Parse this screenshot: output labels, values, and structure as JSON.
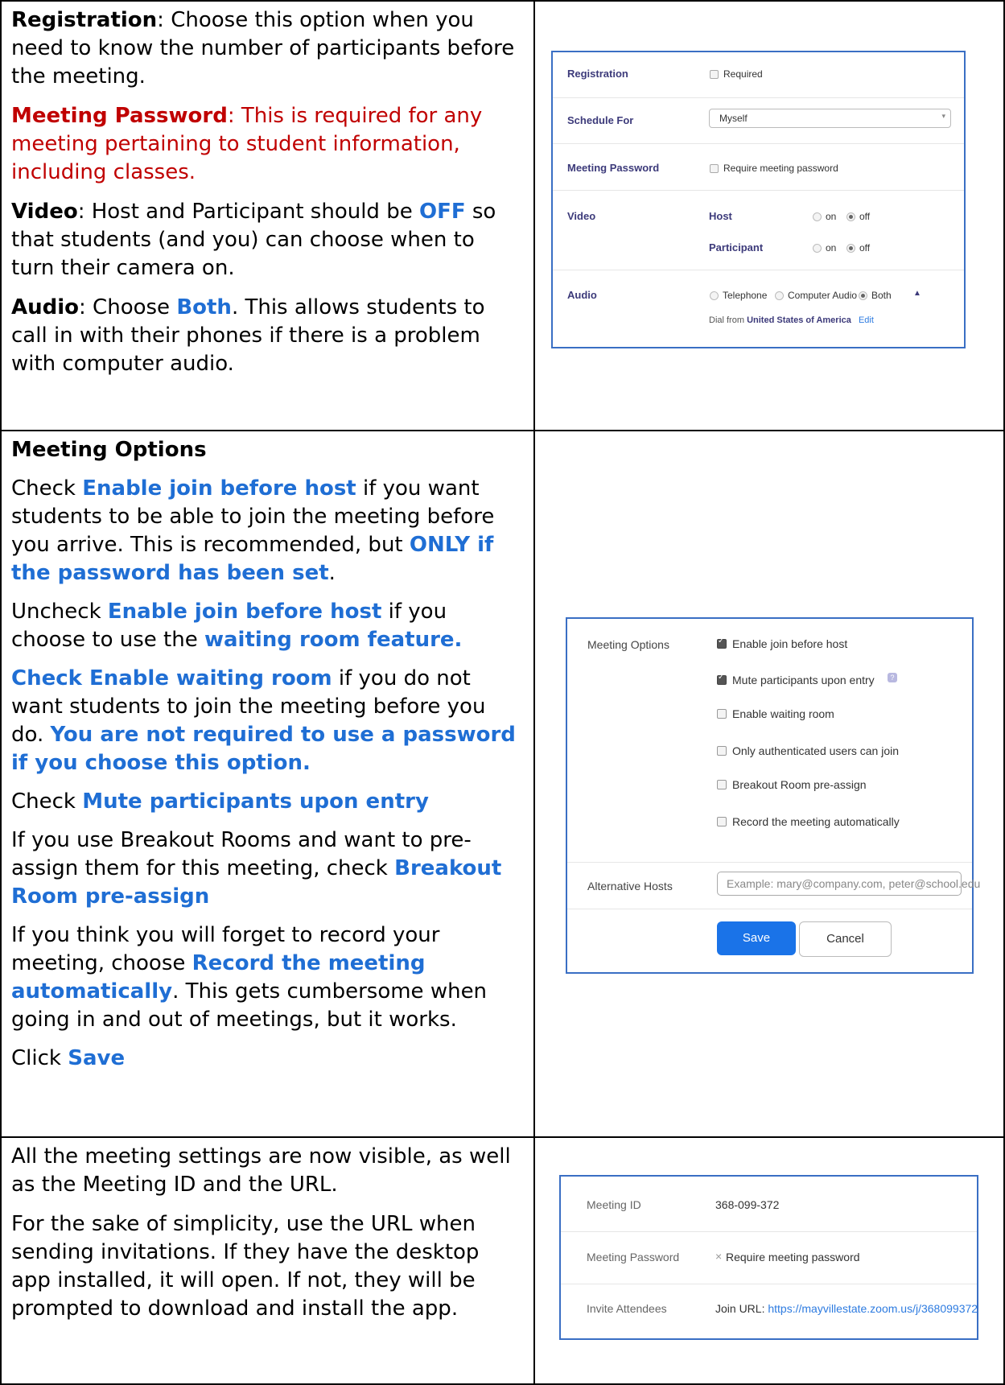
{
  "row1": {
    "reg_label": "Registration",
    "reg_text": ": Choose this option when you need to know the number of participants before the meeting.",
    "pw_label": "Meeting Password",
    "pw_text": ": This is required for any meeting pertaining to student information, including classes.",
    "video_label": "Video",
    "video_text_a": ": Host and Participant should be ",
    "video_off": "OFF",
    "video_text_b": " so that students (and you) can choose when to turn their camera on.",
    "audio_label": "Audio",
    "audio_text_a": ": Choose ",
    "audio_both": "Both",
    "audio_text_b": ". This allows students to call in with their phones if there is a problem with computer audio."
  },
  "panel1": {
    "registration": "Registration",
    "required": "Required",
    "schedule_for": "Schedule For",
    "myself": "Myself",
    "meeting_password": "Meeting Password",
    "require_pw": "Require meeting password",
    "video": "Video",
    "host": "Host",
    "participant": "Participant",
    "on": "on",
    "off": "off",
    "audio": "Audio",
    "telephone": "Telephone",
    "computer_audio": "Computer Audio",
    "both": "Both",
    "dial_from": "Dial from",
    "country": "United States of America",
    "edit": "Edit"
  },
  "row2": {
    "heading": "Meeting Options",
    "p1_a": "Check ",
    "p1_b": "Enable join before host",
    "p1_c": " if you want students to be able to join the meeting before you arrive. This is recommended, but ",
    "p1_d": "ONLY if the password has been set",
    "p1_e": ".",
    "p2_a": "Uncheck ",
    "p2_b": "Enable join before host",
    "p2_c": " if you choose to use the ",
    "p2_d": "waiting room feature.",
    "p3_a": "Check Enable waiting room",
    "p3_b": " if you do not want students to join the meeting before you do. ",
    "p3_c": "You are not required to use a password if you choose this option.",
    "p4_a": "Check ",
    "p4_b": "Mute participants upon entry",
    "p5_a": "If you use Breakout Rooms and want to pre-assign them for this meeting, check ",
    "p5_b": "Breakout Room pre-assign",
    "p6_a": "If you think you will forget to record your meeting, choose ",
    "p6_b": "Record the meeting automatically",
    "p6_c": ". This gets cumbersome when going in and out of meetings, but it works.",
    "p7_a": "Click ",
    "p7_b": "Save"
  },
  "panel2": {
    "meeting_options": "Meeting Options",
    "opt1": "Enable join before host",
    "opt2": "Mute participants upon entry",
    "opt3": "Enable waiting room",
    "opt4": "Only authenticated users can join",
    "opt5": "Breakout Room pre-assign",
    "opt6": "Record the meeting automatically",
    "alt_hosts": "Alternative Hosts",
    "alt_placeholder": "Example: mary@company.com, peter@school.edu",
    "save": "Save",
    "cancel": "Cancel"
  },
  "row3": {
    "p1": "All the meeting settings are now visible, as well as the Meeting ID and the URL.",
    "p2": "For the sake of simplicity, use the URL when sending invitations. If they have the desktop app installed, it will open. If not, they will be prompted to download and install the app."
  },
  "panel3": {
    "meeting_id_label": "Meeting ID",
    "meeting_id": "368-099-372",
    "pw_label": "Meeting Password",
    "pw_value": "Require meeting password",
    "invite_label": "Invite Attendees",
    "join_url_label": "Join URL:",
    "join_url": "https://mayvillestate.zoom.us/j/368099372"
  }
}
